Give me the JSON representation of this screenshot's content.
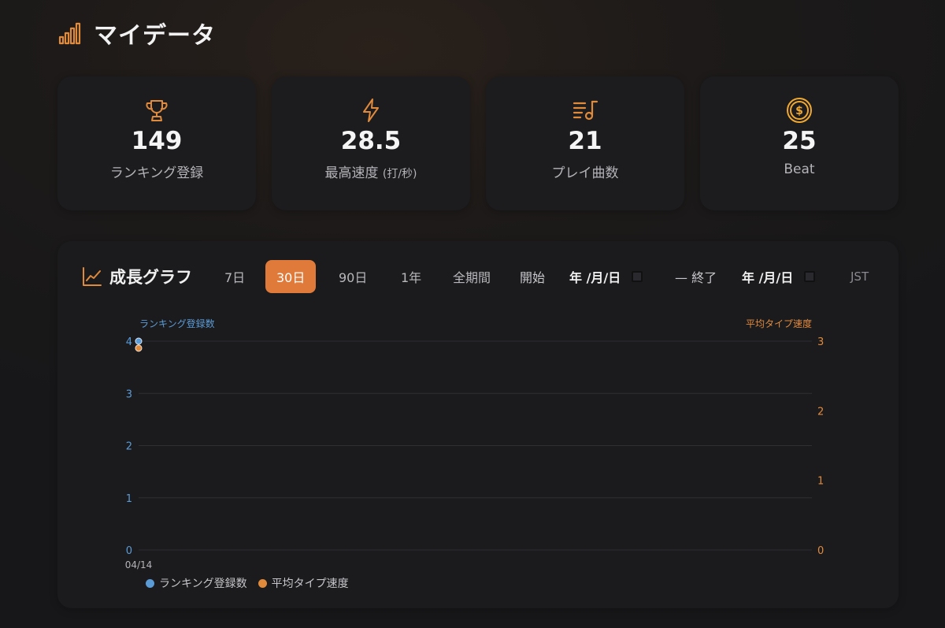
{
  "header": {
    "title": "マイデータ",
    "icon": "bar-chart-icon"
  },
  "stats": [
    {
      "icon": "trophy-icon",
      "value": "149",
      "label": "ランキング登録",
      "unit": ""
    },
    {
      "icon": "lightning-icon",
      "value": "28.5",
      "label": "最高速度",
      "unit": "(打/秒)"
    },
    {
      "icon": "music-list-icon",
      "value": "21",
      "label": "プレイ曲数",
      "unit": ""
    },
    {
      "icon": "coin-icon",
      "value": "25",
      "label": "Beat",
      "unit": ""
    }
  ],
  "graph": {
    "title": "成長グラフ",
    "icon": "line-chart-icon",
    "ranges": [
      "7日",
      "30日",
      "90日",
      "1年",
      "全期間"
    ],
    "active_range": "30日",
    "start_label": "開始",
    "end_label": "— 終了",
    "start_date": "年 /月/日",
    "end_date": "年 /月/日",
    "timezone": "JST"
  },
  "colors": {
    "accent": "#e07a3a",
    "blue": "#5b9bd5",
    "orange": "#e08a3c"
  },
  "chart_data": {
    "type": "scatter",
    "x": [
      "04/14"
    ],
    "series": [
      {
        "name": "ランキング登録数",
        "axis": "left",
        "values": [
          4
        ]
      },
      {
        "name": "平均タイプ速度",
        "axis": "right",
        "values": [
          2.9
        ]
      }
    ],
    "y_left_label": "ランキング登録数",
    "y_right_label": "平均タイプ速度",
    "y_left_range": [
      0,
      4
    ],
    "y_right_range": [
      0,
      3
    ],
    "y_left_ticks": [
      "0",
      "1",
      "2",
      "3",
      "4"
    ],
    "y_right_ticks": [
      "0",
      "1",
      "2",
      "3"
    ],
    "legend": [
      "ランキング登録数",
      "平均タイプ速度"
    ],
    "legend_position": "bottom-left",
    "grid": true
  }
}
